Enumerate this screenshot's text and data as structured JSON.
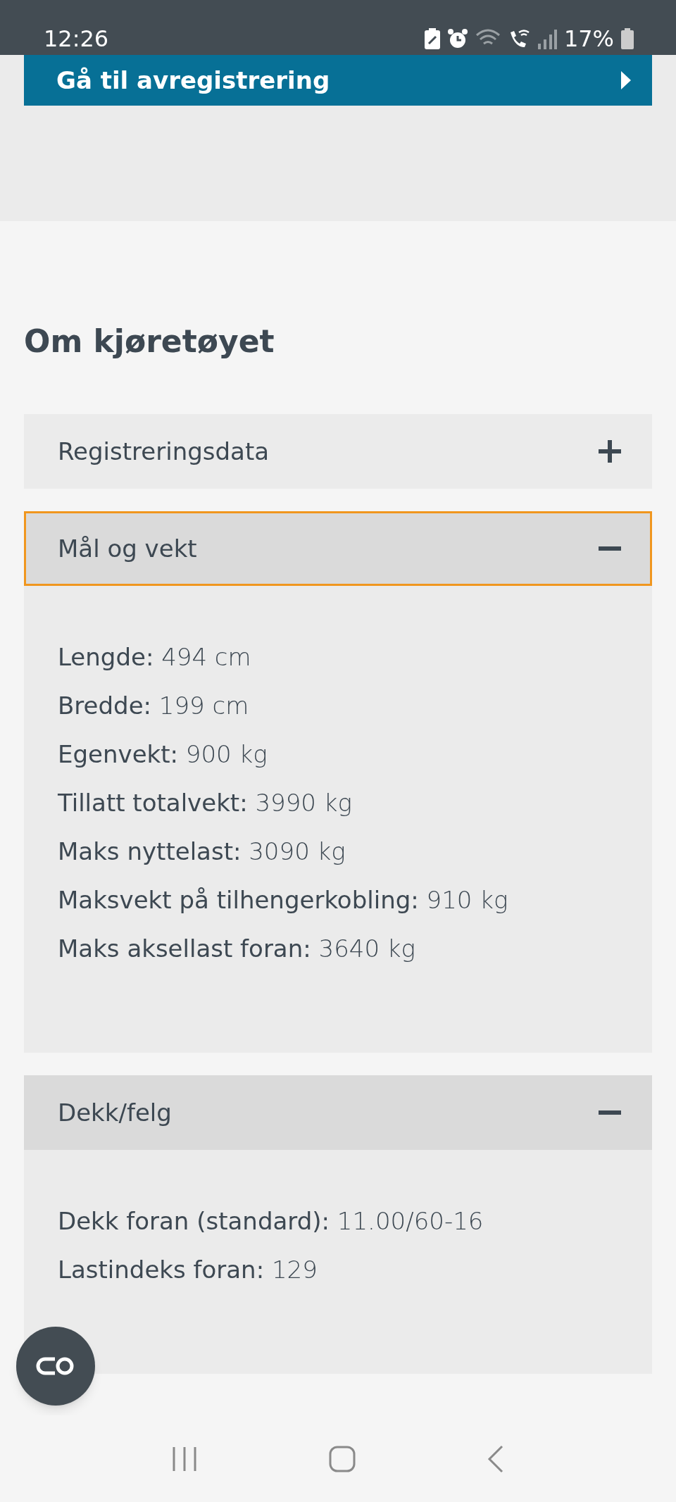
{
  "status_bar": {
    "time": "12:26",
    "battery": "17%"
  },
  "top_button": {
    "label": "Gå til avregistrering"
  },
  "heading": "Om kjøretøyet",
  "sections": [
    {
      "title": "Registreringsdata",
      "expanded": false,
      "focused": false
    },
    {
      "title": "Mål og vekt",
      "expanded": true,
      "focused": true,
      "rows": [
        "**Lengde:** 494 cm",
        "**Bredde:** 199 cm",
        "**Egenvekt:** 900 kg",
        "**Tillatt totalvekt:** 3990 kg",
        "**Maks nyttelast:** 3090 kg",
        "**Maksvekt på tilhengerkobling:** 910 kg",
        "**Maks aksellast foran:** 3640 kg"
      ]
    },
    {
      "title": "Dekk/felg",
      "expanded": true,
      "focused": false,
      "rows": [
        "**Dekk foran (standard):** 11.00/60-16",
        "**Lastindeks foran:** 129"
      ]
    }
  ]
}
